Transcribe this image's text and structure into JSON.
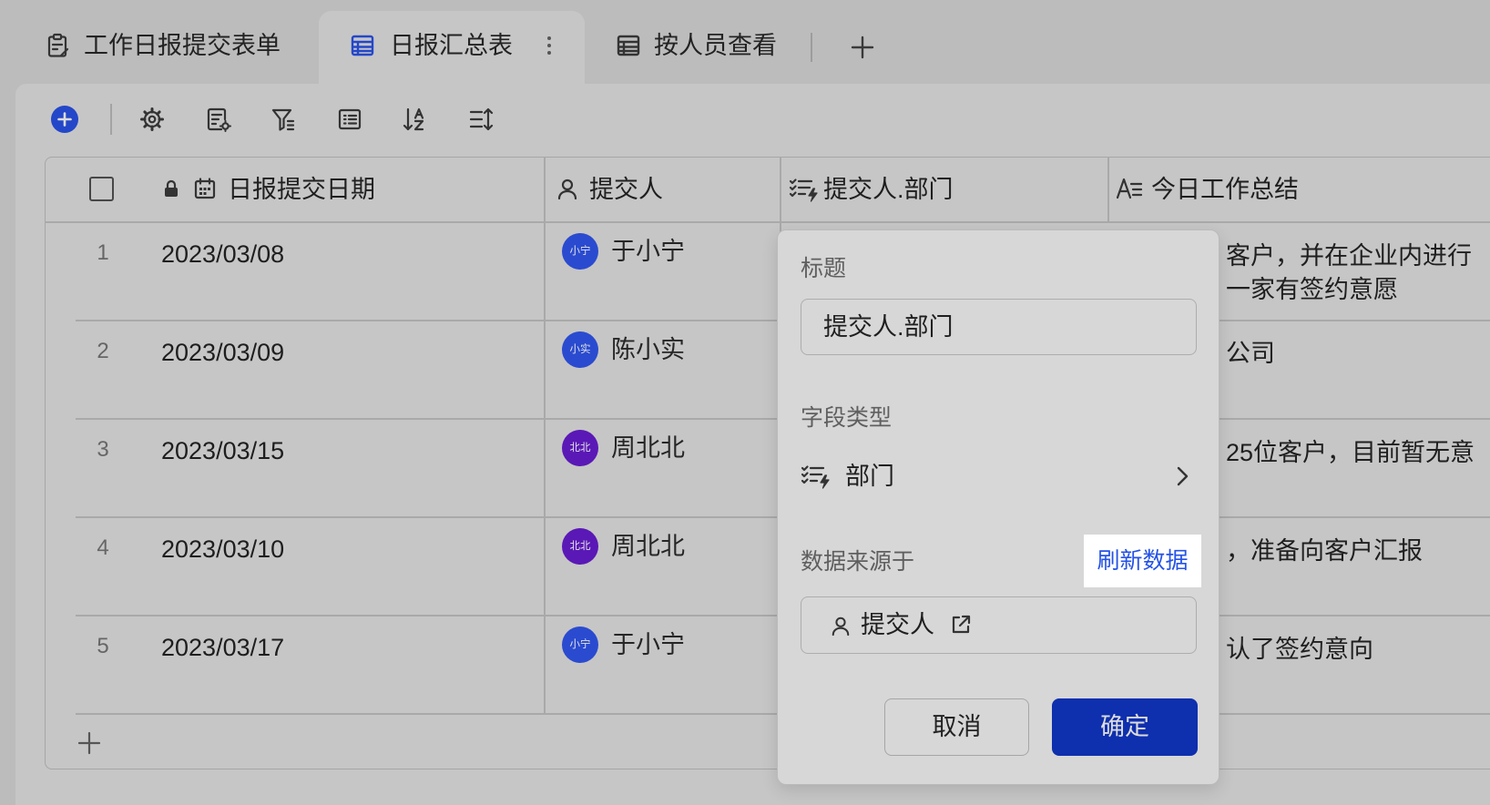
{
  "tabs": {
    "items": [
      {
        "label": "工作日报提交表单",
        "icon": "form-icon",
        "active": false
      },
      {
        "label": "日报汇总表",
        "icon": "grid-table-icon",
        "active": true
      },
      {
        "label": "按人员查看",
        "icon": "grid-table-icon",
        "active": false
      }
    ],
    "add_icon": "plus-icon"
  },
  "toolbar": {
    "icons": [
      "add-record-icon",
      "settings-icon",
      "form-settings-icon",
      "filter-icon",
      "group-icon",
      "sort-icon",
      "row-height-icon"
    ]
  },
  "table": {
    "columns": [
      {
        "label": "日报提交日期",
        "icon": "calendar-icon",
        "locked": true
      },
      {
        "label": "提交人",
        "icon": "person-icon"
      },
      {
        "label": "提交人.部门",
        "icon": "department-lookup-icon"
      },
      {
        "label": "今日工作总结",
        "icon": "text-field-icon"
      }
    ],
    "rows": [
      {
        "index": "1",
        "date": "2023/03/08",
        "avatar_text": "小宁",
        "avatar_color": "#2a4bd0",
        "name": "于小宁",
        "summary": [
          "客户，并在企业内进行",
          "一家有签约意愿"
        ]
      },
      {
        "index": "2",
        "date": "2023/03/09",
        "avatar_text": "小实",
        "avatar_color": "#2a4bd0",
        "name": "陈小实",
        "summary": [
          "公司"
        ]
      },
      {
        "index": "3",
        "date": "2023/03/15",
        "avatar_text": "北北",
        "avatar_color": "#5a18b6",
        "name": "周北北",
        "summary": [
          "25位客户，目前暂无意"
        ]
      },
      {
        "index": "4",
        "date": "2023/03/10",
        "avatar_text": "北北",
        "avatar_color": "#5a18b6",
        "name": "周北北",
        "summary": [
          "，准备向客户汇报"
        ]
      },
      {
        "index": "5",
        "date": "2023/03/17",
        "avatar_text": "小宁",
        "avatar_color": "#2a4bd0",
        "name": "于小宁",
        "summary": [
          "认了签约意向"
        ]
      }
    ]
  },
  "field_editor": {
    "title_label": "标题",
    "title_value": "提交人.部门",
    "field_type_label": "字段类型",
    "field_type_value": "部门",
    "source_label": "数据来源于",
    "refresh_label": "刷新数据",
    "source_value": "提交人",
    "cancel_label": "取消",
    "confirm_label": "确定"
  },
  "colors": {
    "accent": "#2447c9",
    "confirm_bg": "#0e2fae",
    "refresh_text": "#2453e6"
  }
}
